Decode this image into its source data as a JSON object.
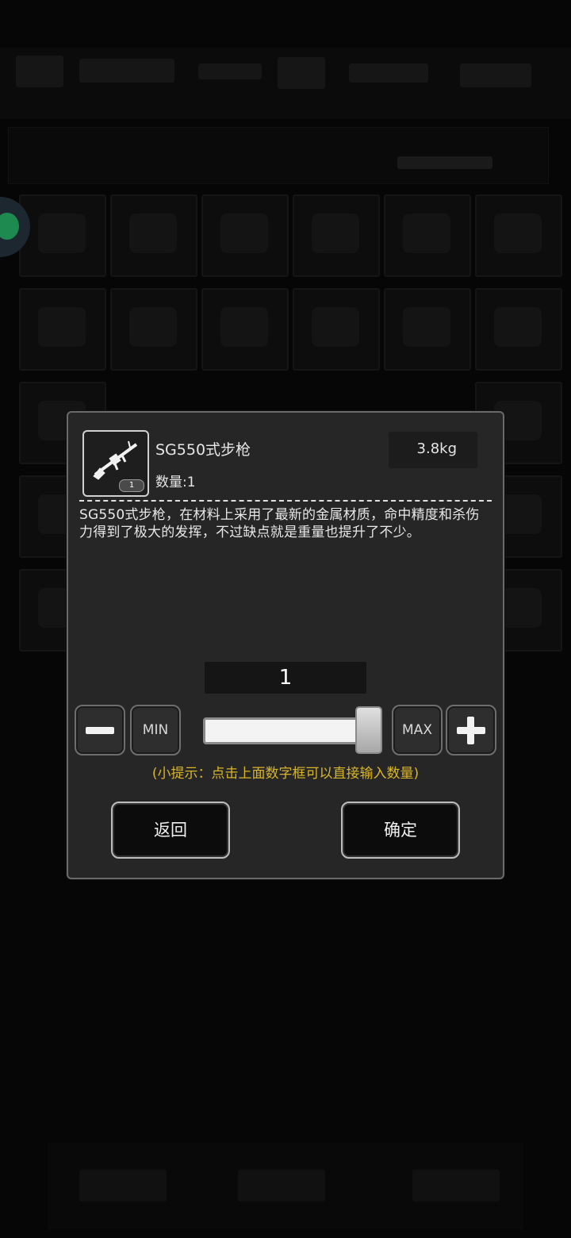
{
  "item": {
    "name": "SG550式步枪",
    "count_label": "数量:1",
    "weight": "3.8kg",
    "slot_quantity": "1",
    "icon": "rifle-icon",
    "description": "SG550式步枪，在材料上采用了最新的金属材质，命中精度和杀伤力得到了极大的发挥，不过缺点就是重量也提升了不少。"
  },
  "quantity": {
    "value": "1",
    "min_label": "MIN",
    "max_label": "MAX",
    "slider_fraction": 1.0
  },
  "hint": "(小提示：点击上面数字框可以直接输入数量)",
  "buttons": {
    "back": "返回",
    "confirm": "确定"
  },
  "colors": {
    "hint": "#d9b52a",
    "dialog_bg": "#262626",
    "floating_ball": "#1f8a4f"
  }
}
